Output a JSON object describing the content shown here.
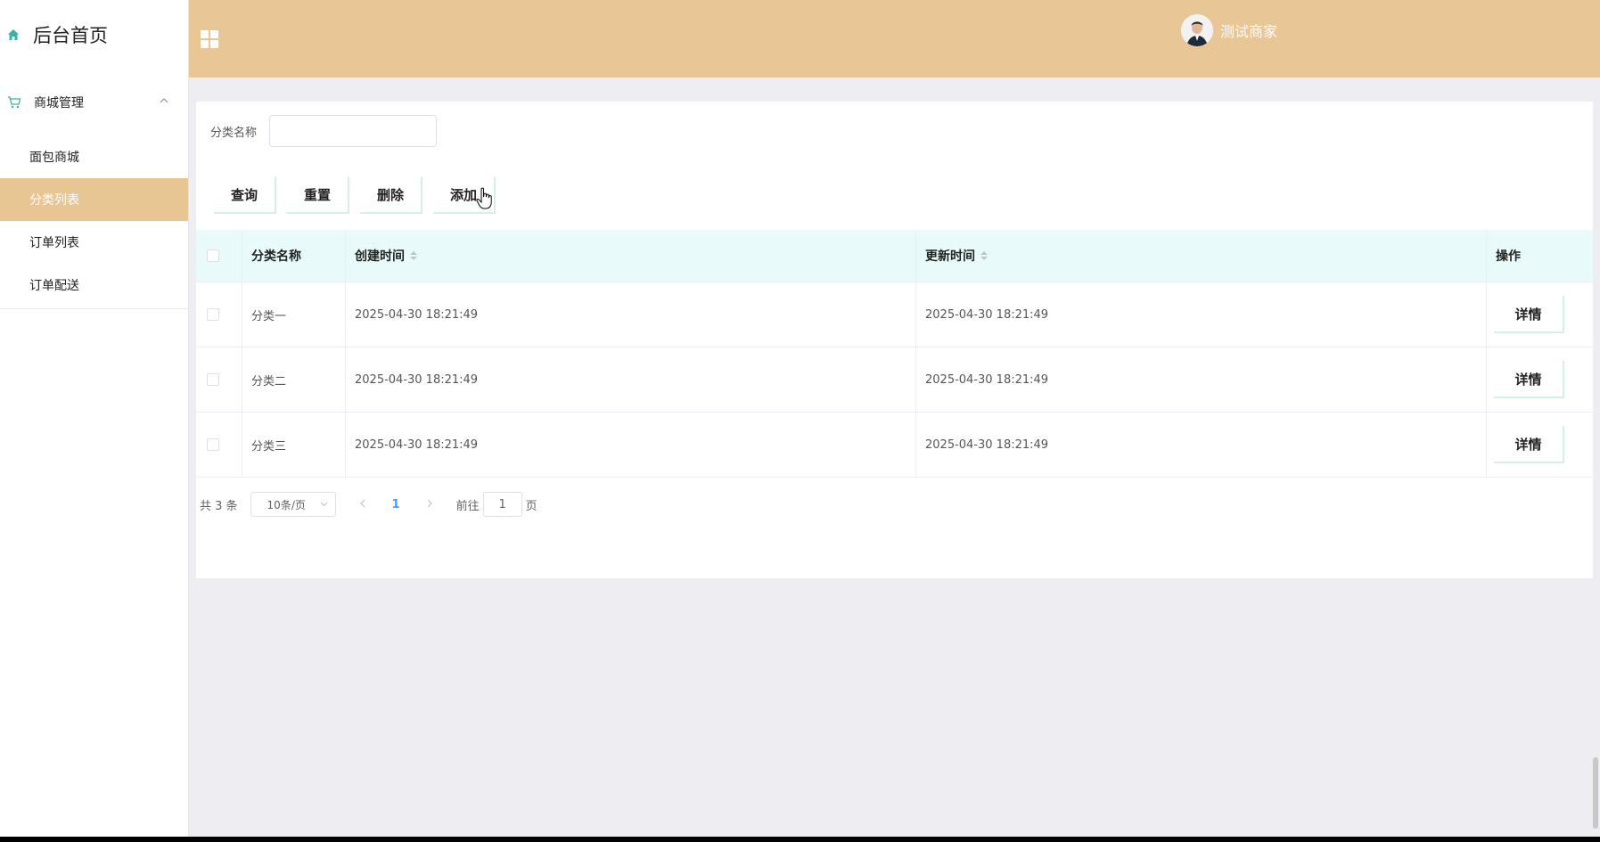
{
  "sidebar": {
    "brand": "后台首页",
    "group": "商城管理",
    "items": [
      {
        "label": "面包商城"
      },
      {
        "label": "分类列表"
      },
      {
        "label": "订单列表"
      },
      {
        "label": "订单配送"
      }
    ]
  },
  "header": {
    "username": "测试商家"
  },
  "search": {
    "label": "分类名称",
    "value": ""
  },
  "buttons": {
    "query": "查询",
    "reset": "重置",
    "delete": "删除",
    "add": "添加"
  },
  "table": {
    "headers": {
      "name": "分类名称",
      "created": "创建时间",
      "updated": "更新时间",
      "ops": "操作"
    },
    "rows": [
      {
        "name": "分类一",
        "created": "2025-04-30 18:21:49",
        "updated": "2025-04-30 18:21:49",
        "action": "详情"
      },
      {
        "name": "分类二",
        "created": "2025-04-30 18:21:49",
        "updated": "2025-04-30 18:21:49",
        "action": "详情"
      },
      {
        "name": "分类三",
        "created": "2025-04-30 18:21:49",
        "updated": "2025-04-30 18:21:49",
        "action": "详情"
      }
    ]
  },
  "pagination": {
    "total": "共 3 条",
    "page_size": "10条/页",
    "current_page": "1",
    "goto_label": "前往",
    "goto_value": "1",
    "page_suffix": "页"
  },
  "colors": {
    "accent": "#e8c695",
    "table_header_bg": "#e8fbfa",
    "active_page": "#409eff"
  }
}
